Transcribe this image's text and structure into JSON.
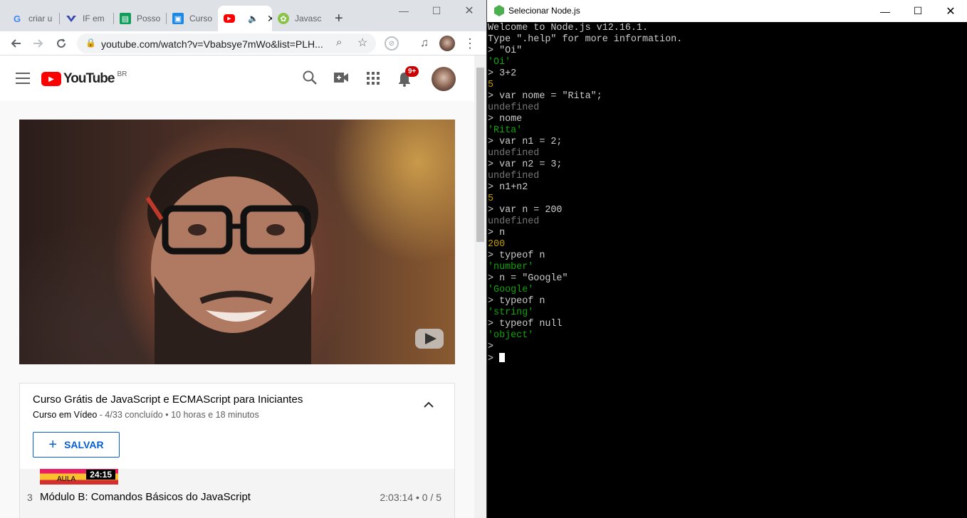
{
  "chrome": {
    "tabs": [
      {
        "label": "criar u",
        "icon": "google-icon"
      },
      {
        "label": "IF em",
        "icon": "ifpr-icon"
      },
      {
        "label": "Posso",
        "icon": "sheets-icon"
      },
      {
        "label": "Curso",
        "icon": "classroom-icon"
      },
      {
        "label": "",
        "icon": "youtube-icon",
        "active": true
      },
      {
        "label": "Javasc",
        "icon": "node-icon"
      }
    ],
    "new_tab_label": "+",
    "url": "youtube.com/watch?v=Vbabsye7mWo&list=PLH..."
  },
  "youtube": {
    "logo_text": "YouTube",
    "region": "BR",
    "notification_count": "9+",
    "playlist": {
      "title": "Curso Grátis de JavaScript e ECMAScript para Iniciantes",
      "channel": "Curso em Vídeo",
      "progress": " - 4/33 concluído • 10 horas e 18 minutos",
      "save_label": "SALVAR",
      "thumb_duration": "24:15",
      "thumb_text": "AULA",
      "item_index": "3",
      "item_title": "Módulo B: Comandos Básicos do JavaScript",
      "item_meta": "2:03:14 • 0 / 5"
    }
  },
  "node": {
    "window_title": "Selecionar Node.js",
    "lines": [
      {
        "text": "Welcome to Node.js v12.16.1.",
        "kind": "plain"
      },
      {
        "text": "Type \".help\" for more information.",
        "kind": "plain"
      },
      {
        "text": "> \"Oi\"",
        "kind": "in"
      },
      {
        "text": "'Oi'",
        "kind": "str"
      },
      {
        "text": "> 3+2",
        "kind": "in"
      },
      {
        "text": "5",
        "kind": "num"
      },
      {
        "text": "> var nome = \"Rita\";",
        "kind": "in"
      },
      {
        "text": "undefined",
        "kind": "undef"
      },
      {
        "text": "> nome",
        "kind": "in"
      },
      {
        "text": "'Rita'",
        "kind": "str"
      },
      {
        "text": "> var n1 = 2;",
        "kind": "in"
      },
      {
        "text": "undefined",
        "kind": "undef"
      },
      {
        "text": "> var n2 = 3;",
        "kind": "in"
      },
      {
        "text": "undefined",
        "kind": "undef"
      },
      {
        "text": "> n1+n2",
        "kind": "in"
      },
      {
        "text": "5",
        "kind": "num"
      },
      {
        "text": "> var n = 200",
        "kind": "in"
      },
      {
        "text": "undefined",
        "kind": "undef"
      },
      {
        "text": "> n",
        "kind": "in"
      },
      {
        "text": "200",
        "kind": "num"
      },
      {
        "text": "> typeof n",
        "kind": "in"
      },
      {
        "text": "'number'",
        "kind": "str"
      },
      {
        "text": "> n = \"Google\"",
        "kind": "in"
      },
      {
        "text": "'Google'",
        "kind": "str"
      },
      {
        "text": "> typeof n",
        "kind": "in"
      },
      {
        "text": "'string'",
        "kind": "str"
      },
      {
        "text": "> typeof null",
        "kind": "in"
      },
      {
        "text": "'object'",
        "kind": "str"
      },
      {
        "text": ">",
        "kind": "in"
      },
      {
        "text": "> ",
        "kind": "prompt"
      }
    ]
  },
  "colors": {
    "youtube_red": "#ff0000",
    "console_green": "#13a10e",
    "console_yellow": "#c19c00",
    "console_gray": "#767676",
    "link_blue": "#065fd4"
  }
}
